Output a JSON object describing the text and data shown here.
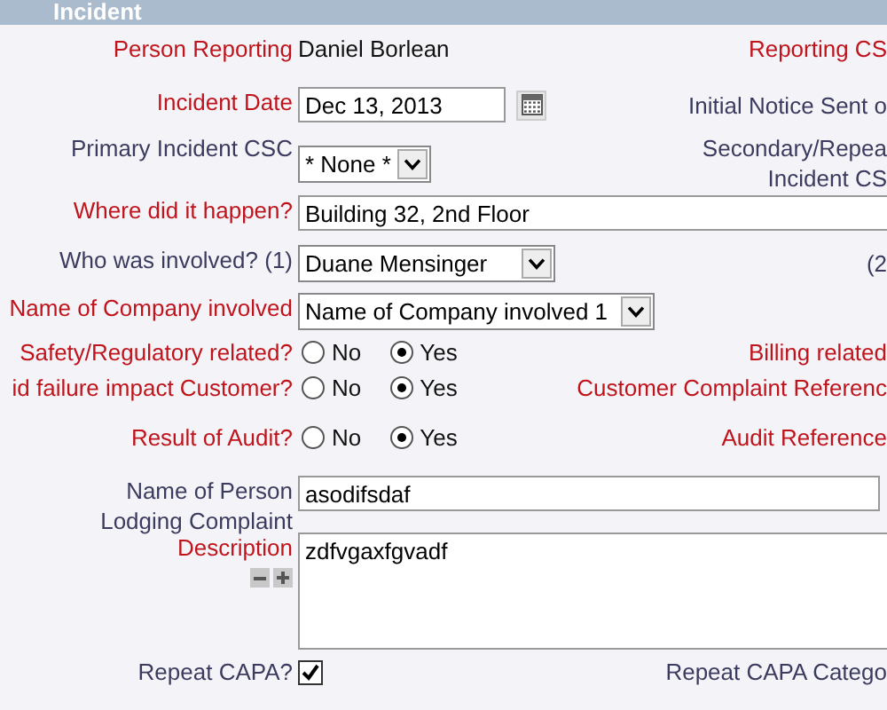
{
  "section": {
    "title": "Incident"
  },
  "rows": [
    {
      "kind": "text",
      "label": "Person Reporting",
      "required": true,
      "value": "Daniel Borlean",
      "right_label": {
        "text": "Reporting CS",
        "required": true
      }
    },
    {
      "kind": "date",
      "label": "Incident Date",
      "required": true,
      "value": "Dec 13, 2013",
      "right_label": {
        "text": "Initial Notice Sent o",
        "required": false
      }
    },
    {
      "kind": "select",
      "label": "Primary Incident CSC",
      "required": false,
      "value": "* None *",
      "right_label": {
        "text": "Secondary/Repea\nIncident CS",
        "required": false
      }
    },
    {
      "kind": "input",
      "label": "Where did it happen?",
      "required": true,
      "value": "Building 32, 2nd Floor"
    },
    {
      "kind": "select",
      "label": "Who was involved? (1)",
      "required": false,
      "value": "Duane Mensinger",
      "right_label": {
        "text": "(2",
        "required": false
      }
    },
    {
      "kind": "select",
      "label": "Name of Company involved",
      "required": true,
      "value": "Name of Company involved 1"
    },
    {
      "kind": "radio",
      "label": "Safety/Regulatory related?",
      "required": true,
      "options": [
        {
          "label": "No",
          "selected": false
        },
        {
          "label": "Yes",
          "selected": true
        }
      ],
      "right_label": {
        "text": "Billing related",
        "required": true
      }
    },
    {
      "kind": "radio",
      "label": "id failure impact Customer?",
      "required": true,
      "options": [
        {
          "label": "No",
          "selected": false
        },
        {
          "label": "Yes",
          "selected": true
        }
      ],
      "right_label": {
        "text": "Customer Complaint Referenc",
        "required": true
      }
    },
    {
      "kind": "radio",
      "label": "Result of Audit?",
      "required": true,
      "options": [
        {
          "label": "No",
          "selected": false
        },
        {
          "label": "Yes",
          "selected": true
        }
      ],
      "right_label": {
        "text": "Audit Reference",
        "required": true
      }
    },
    {
      "kind": "input",
      "label": "Name of Person\nLodging Complaint",
      "required": false,
      "value": "asodifsdaf"
    },
    {
      "kind": "textarea",
      "label": "Description",
      "required": true,
      "value": "zdfvgaxfgvadf"
    },
    {
      "kind": "checkbox",
      "label": "Repeat CAPA?",
      "required": false,
      "checked": true,
      "right_label": {
        "text": "Repeat CAPA Catego",
        "required": false
      }
    }
  ]
}
